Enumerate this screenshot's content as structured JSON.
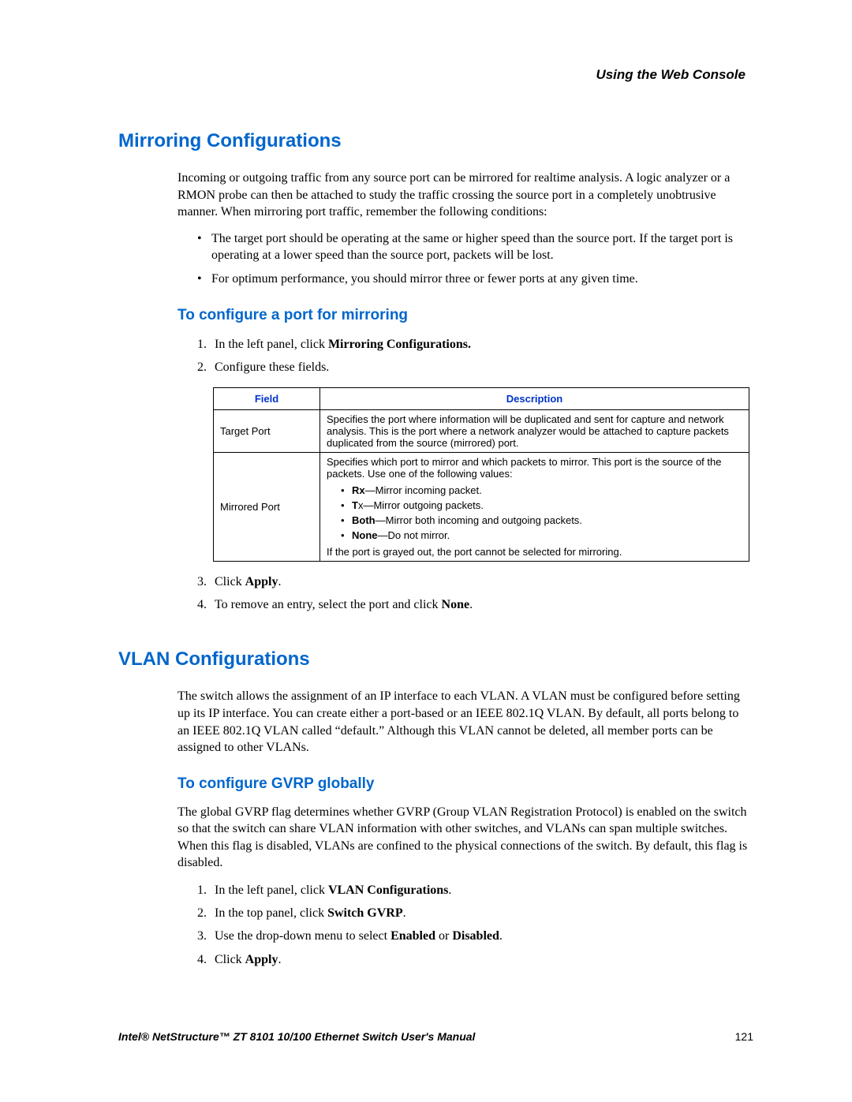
{
  "header": {
    "right": "Using the Web Console"
  },
  "section1": {
    "title": "Mirroring Configurations",
    "intro": "Incoming or outgoing traffic from any source port can be mirrored for realtime analysis. A logic analyzer or a RMON probe can then be attached to study the traffic crossing the source port in a completely unobtrusive manner. When mirroring port traffic, remember the following conditions:",
    "bullets": [
      "The target port should be operating at the same or higher speed than the source port. If the target port is operating at a lower speed than the source port, packets will be lost.",
      "For optimum performance, you should mirror three or fewer ports at any given time."
    ],
    "sub1": {
      "title": "To configure a port for mirroring",
      "step1_a": "In the left panel, click ",
      "step1_b": "Mirroring Configurations.",
      "step2": "Configure these fields.",
      "step3_a": "Click ",
      "step3_b": "Apply",
      "step3_c": ".",
      "step4_a": "To remove an entry, select the port and click ",
      "step4_b": "None",
      "step4_c": "."
    },
    "table": {
      "h1": "Field",
      "h2": "Description",
      "r1c1": "Target Port",
      "r1c2": "Specifies the port where information will be duplicated and sent for capture and network analysis. This is the port where a network analyzer would be attached to capture packets duplicated from the source (mirrored) port.",
      "r2c1": "Mirrored Port",
      "r2c2_intro": "Specifies which port to mirror and which packets to mirror. This port is the source of the packets. Use one of the following values:",
      "r2c2_items": {
        "rx_b": "Rx",
        "rx_t": "—Mirror incoming packet.",
        "tx_b": "T",
        "tx_t": "x—Mirror outgoing packets.",
        "both_b": "Both",
        "both_t": "—Mirror both incoming and outgoing packets.",
        "none_b": "None",
        "none_t": "—Do not mirror."
      },
      "r2c2_outro": "If the port is grayed out, the port cannot be selected for mirroring."
    }
  },
  "section2": {
    "title": "VLAN Configurations",
    "intro": "The switch allows the assignment of an IP interface to each VLAN. A VLAN must be configured before setting up its IP interface. You can create either a port-based or an IEEE 802.1Q VLAN. By default, all ports belong to an IEEE 802.1Q VLAN called “default.” Although this VLAN cannot be deleted, all member ports can be assigned to other VLANs.",
    "sub1": {
      "title": "To configure GVRP globally",
      "para": "The global GVRP flag determines whether GVRP (Group VLAN Registration Protocol) is enabled on the switch so that the switch can share VLAN information with other switches, and VLANs can span multiple switches. When this flag is disabled, VLANs are confined to the physical connections of the switch. By default, this flag is disabled.",
      "step1_a": "In the left panel, click ",
      "step1_b": "VLAN Configurations",
      "step1_c": ".",
      "step2_a": "In the top panel, click ",
      "step2_b": "Switch GVRP",
      "step2_c": ".",
      "step3_a": "Use the drop-down menu to select ",
      "step3_b": "Enabled",
      "step3_c": " or ",
      "step3_d": "Disabled",
      "step3_e": ".",
      "step4_a": "Click ",
      "step4_b": "Apply",
      "step4_c": "."
    }
  },
  "footer": {
    "left": "Intel® NetStructure™  ZT 8101 10/100 Ethernet Switch User's Manual",
    "right": "121"
  }
}
